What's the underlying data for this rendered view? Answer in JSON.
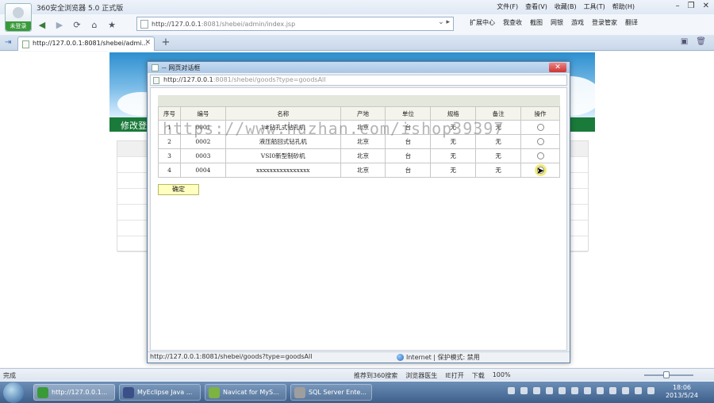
{
  "browser": {
    "app_title": "360安全浏览器 5.0 正式版",
    "logo_caption": "未登录",
    "menus": [
      "文件(F)",
      "查看(V)",
      "收藏(B)",
      "工具(T)",
      "帮助(H)"
    ],
    "address_host": "http://127.0.0.1",
    "address_rest": ":8081/shebei/admin/index.jsp",
    "tools": [
      "扩展中心",
      "我查收",
      "截图",
      "网银",
      "游戏",
      "登录管家",
      "翻译"
    ],
    "tab_label": "http://127.0.0.1:8081/shebei/admi..."
  },
  "page": {
    "green_title": "修改登"
  },
  "dialog": {
    "title": "-- 网页对话框",
    "url_host": "http://127.0.0.1",
    "url_rest": ":8081/shebei/goods?type=goodsAll",
    "columns": [
      "序号",
      "编号",
      "名称",
      "产地",
      "单位",
      "规格",
      "备注",
      "操作"
    ],
    "rows": [
      [
        "1",
        "0001",
        "1#钻孔式钻孔机",
        "北京",
        "台",
        "无",
        "无"
      ],
      [
        "2",
        "0002",
        "液压船回式钻孔机",
        "北京",
        "台",
        "无",
        "无"
      ],
      [
        "3",
        "0003",
        "VSI0新型制砂机",
        "北京",
        "台",
        "无",
        "无"
      ],
      [
        "4",
        "0004",
        "xxxxxxxxxxxxxxxx",
        "北京",
        "台",
        "无",
        "无"
      ]
    ],
    "ok_label": "确定",
    "status_url": "http://127.0.0.1:8081/shebei/goods?type=goodsAll",
    "status_zone": "Internet | 保护模式: 禁用"
  },
  "watermark": "https://www.huzhan.com/ishop39397",
  "statusbar": {
    "left": "完成",
    "items": [
      "推荐到360搜索",
      "浏览器医生",
      "IE打开",
      "下载",
      "100%"
    ]
  },
  "taskbar": {
    "items": [
      {
        "label": "http://127.0.0.1...",
        "color": "#3a9a3a"
      },
      {
        "label": "MyEclipse Java ...",
        "color": "#3b4f88"
      },
      {
        "label": "Navicat for MyS...",
        "color": "#7cb342"
      },
      {
        "label": "SQL Server Ente...",
        "color": "#9e9e9e"
      }
    ],
    "time": "18:06",
    "date": "2013/5/24"
  }
}
